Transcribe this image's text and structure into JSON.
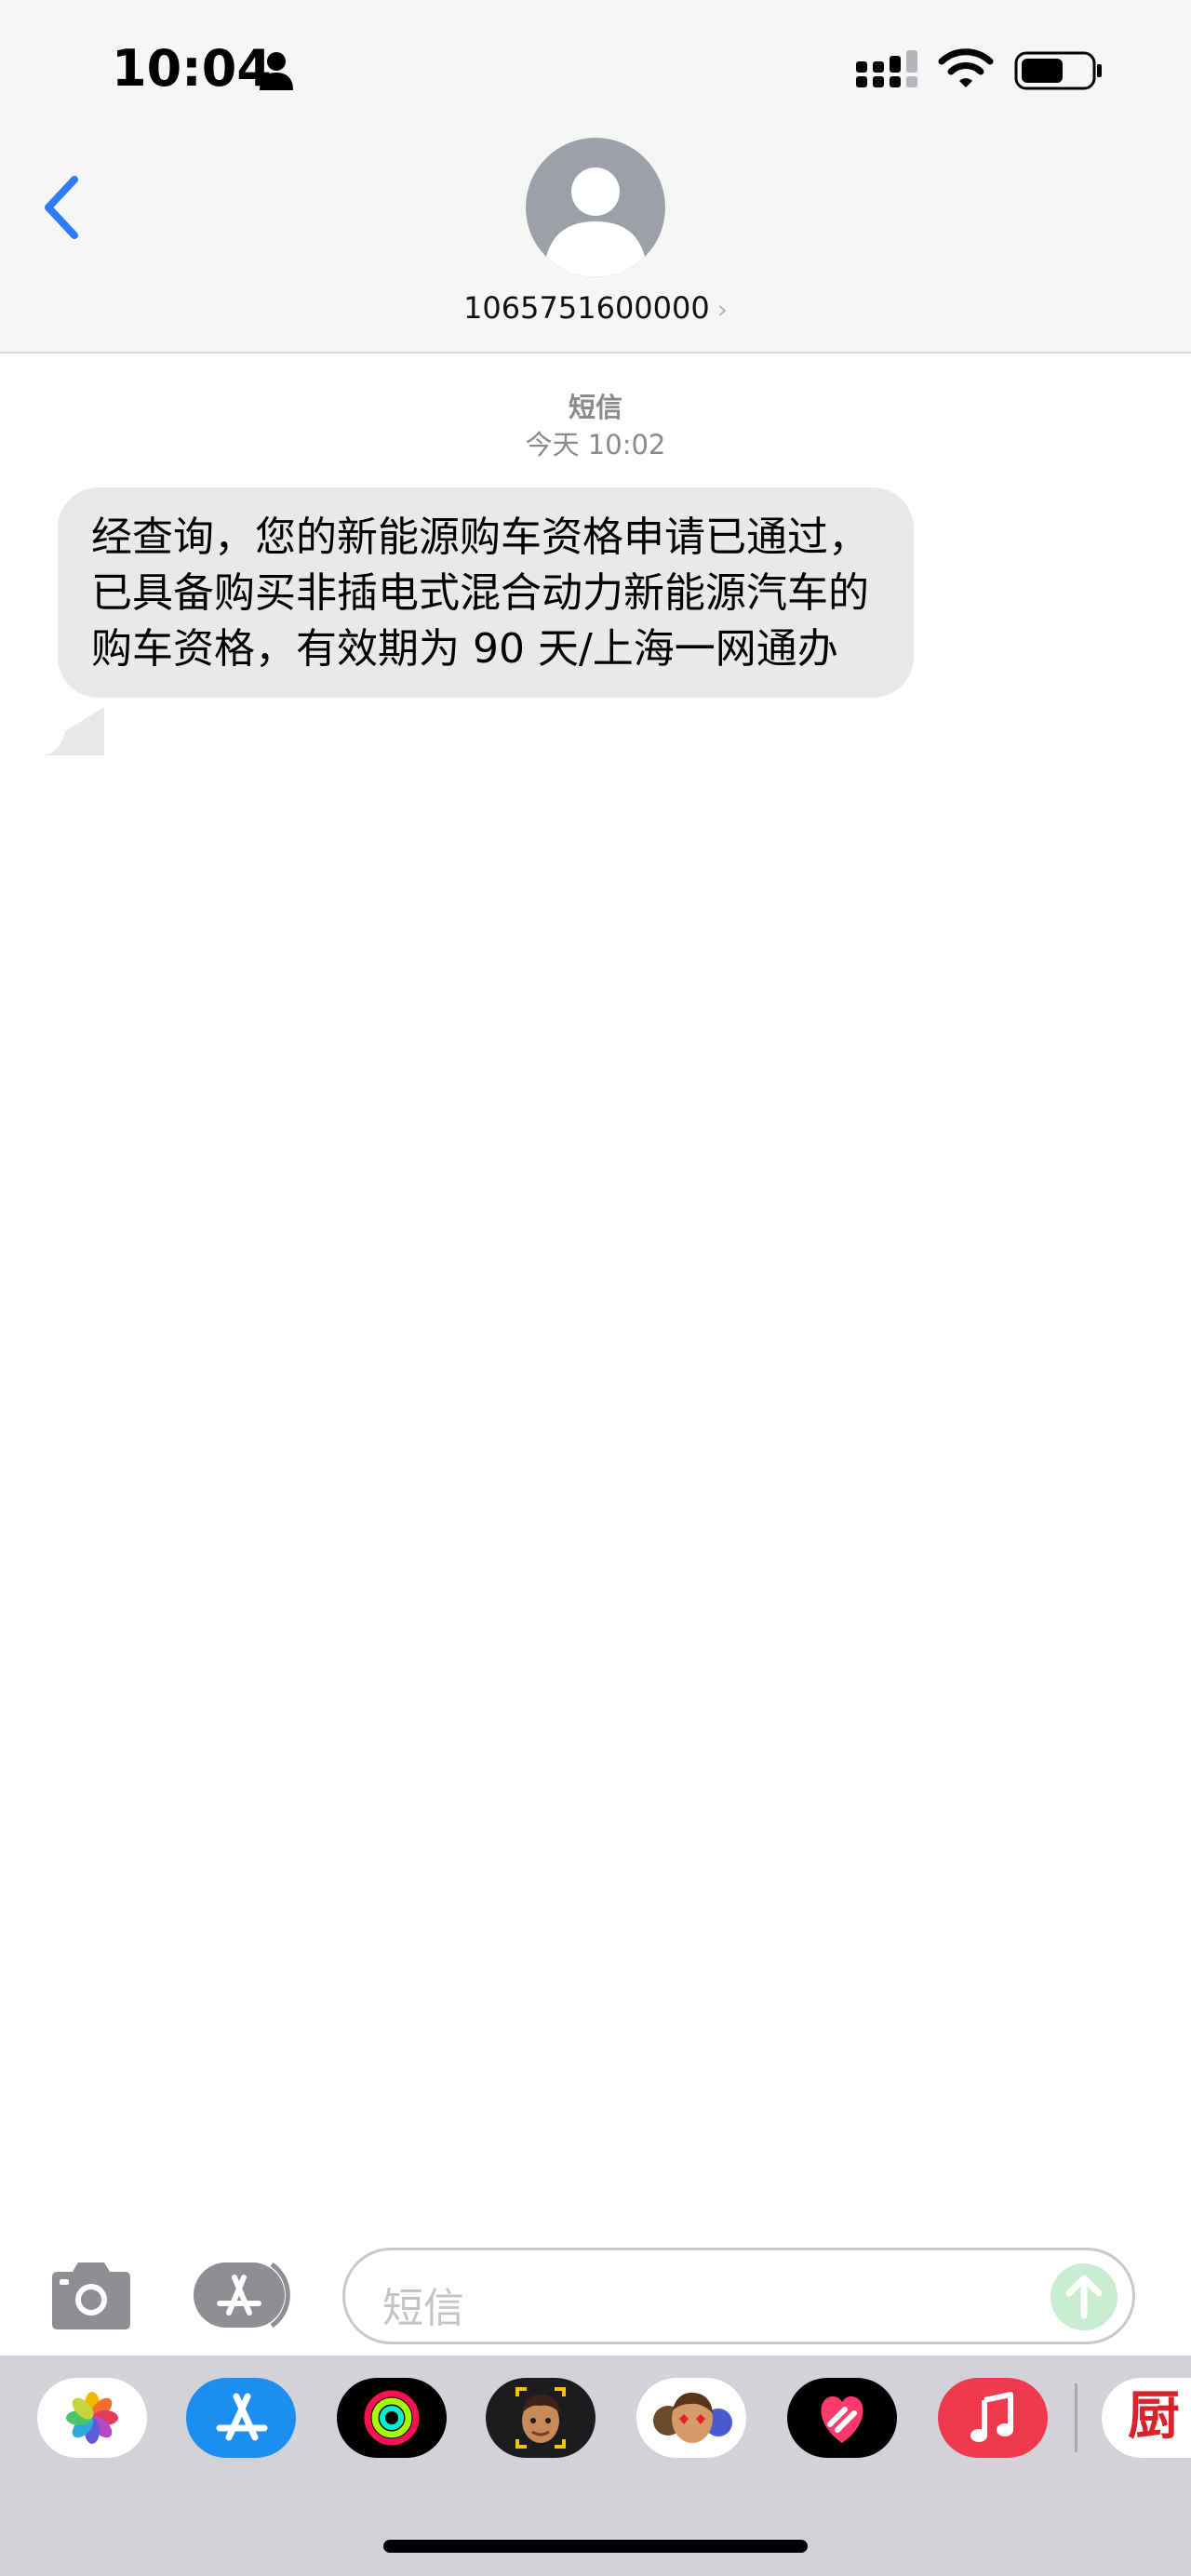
{
  "status_bar": {
    "time": "10:04"
  },
  "header": {
    "contact_name": "1065751600000",
    "contact_chevron": "›",
    "icons": [
      "back-chevron-icon",
      "avatar-icon"
    ]
  },
  "conversation": {
    "service": "短信",
    "timestamp": "今天 10:02",
    "messages": [
      {
        "direction": "incoming",
        "text": "经查询，您的新能源购车资格申请已通过，已具备购买非插电式混合动力新能源汽车的购车资格，有效期为 90 天/上海一网通办"
      }
    ]
  },
  "input_bar": {
    "placeholder": "短信",
    "icons": [
      "camera-icon",
      "app-store-icon",
      "send-arrow-icon"
    ]
  },
  "app_drawer": {
    "apps": [
      "photos-app-icon",
      "app-store-app-icon",
      "fitness-app-icon",
      "memoji-app-icon",
      "animoji-stickers-app-icon",
      "digital-touch-app-icon",
      "music-app-icon",
      "kitchen-app-icon"
    ],
    "kitchen_app_glyph": "厨"
  },
  "colors": {
    "accent": "#2f7cf6",
    "incoming_bubble": "#e9e9eb",
    "header_bg": "#f6f6f6",
    "drawer_bg": "#d2d3d8",
    "send_button": "#c9ecd2"
  }
}
